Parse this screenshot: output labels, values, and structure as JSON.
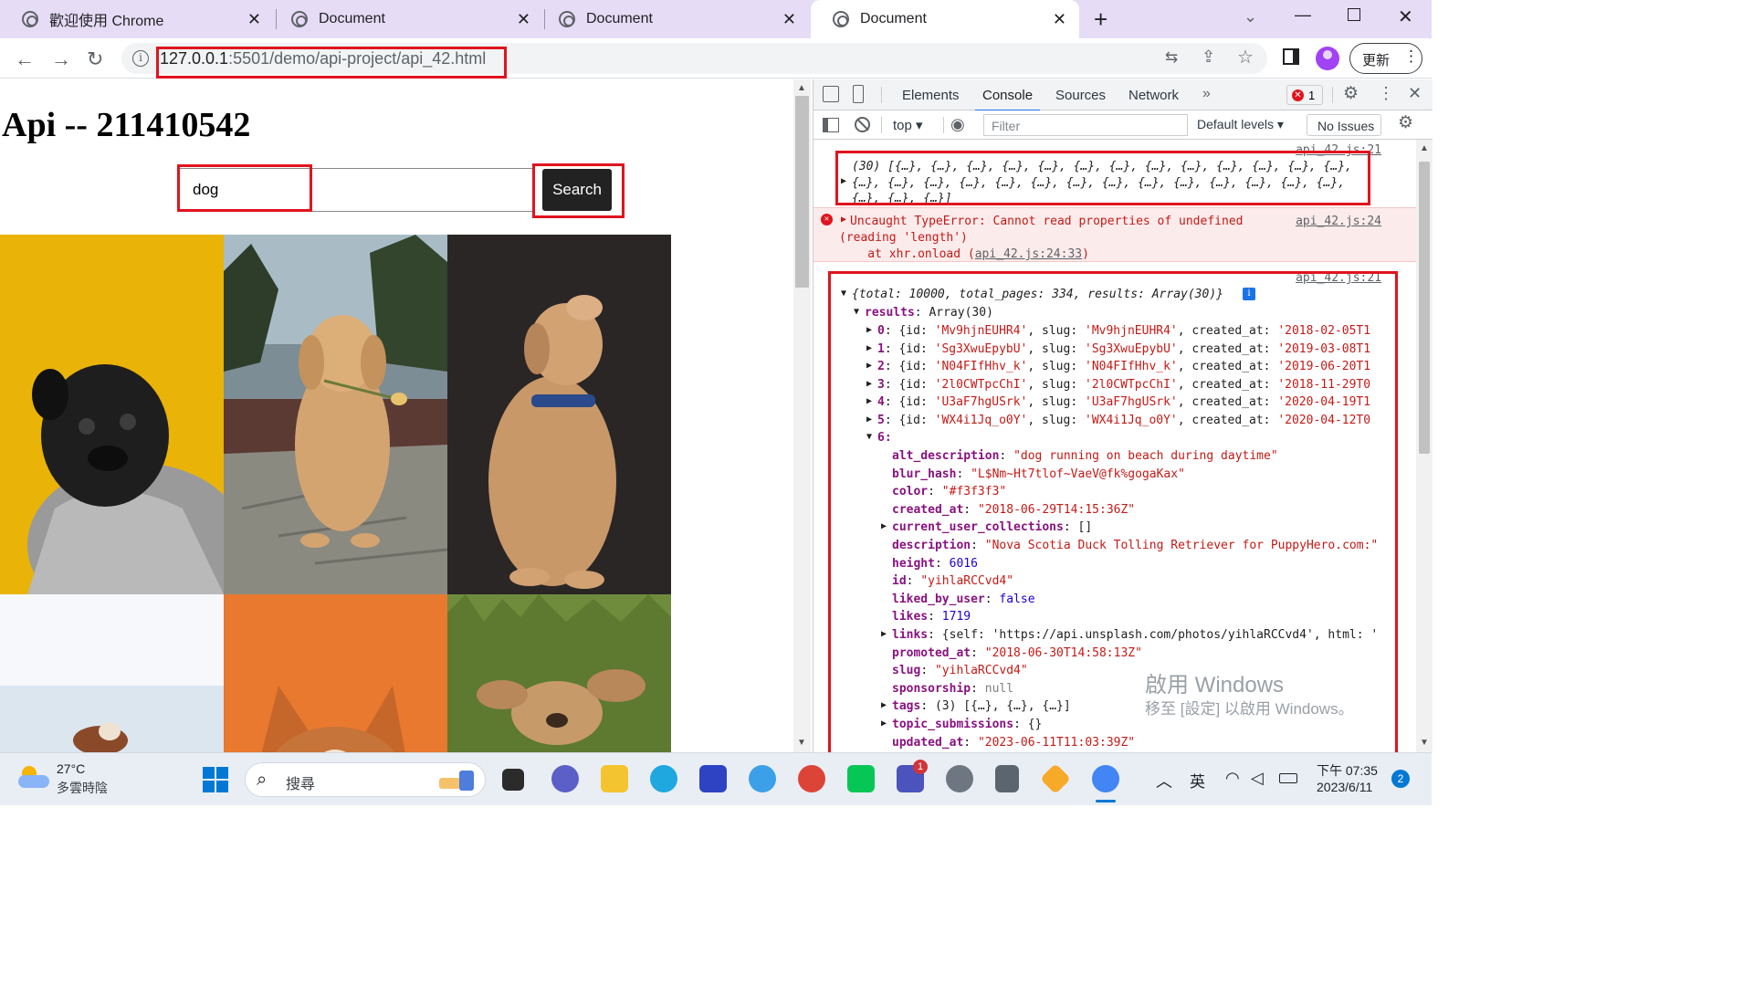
{
  "browser": {
    "tabs": [
      {
        "title": "歡迎使用 Chrome",
        "active": false
      },
      {
        "title": "Document",
        "active": false
      },
      {
        "title": "Document",
        "active": false
      },
      {
        "title": "Document",
        "active": true
      }
    ],
    "new_tab_label": "+",
    "url_host": "127.0.0.1",
    "url_rest": ":5501/demo/api-project/api_42.html",
    "update_button": "更新"
  },
  "page": {
    "title": "Api -- 211410542",
    "search_value": "dog",
    "search_button": "Search",
    "tiles": [
      {
        "subject": "black pug in grey sweater",
        "bg": "#e9b308"
      },
      {
        "subject": "golden retriever puppy holding rose",
        "bg": "#8b8a7e"
      },
      {
        "subject": "labrador with blue collar",
        "bg": "#2a2626"
      },
      {
        "subject": "dog on beach",
        "bg": "#f4f6f8"
      },
      {
        "subject": "corgi on orange background",
        "bg": "#e8792f"
      },
      {
        "subject": "puppy in grass",
        "bg": "#6e8a3e"
      }
    ]
  },
  "devtools": {
    "tabs": [
      "Elements",
      "Console",
      "Sources",
      "Network"
    ],
    "active_tab": "Console",
    "error_count": "1",
    "context": "top",
    "filter_placeholder": "Filter",
    "levels": "Default levels",
    "issues": "No Issues",
    "log1": {
      "source": "api_42.js:21",
      "line1": "(30) [{…}, {…}, {…}, {…}, {…}, {…}, {…}, {…}, {…}, {…}, {…}, {…}, {…},",
      "line2": "{…}, {…}, {…}, {…}, {…}, {…}, {…}, {…}, {…}, {…}, {…}, {…}, {…}, {…},",
      "line3": "{…}, {…}, {…}]"
    },
    "error": {
      "source": "api_42.js:24",
      "line1": "Uncaught TypeError: Cannot read properties of undefined",
      "line2": "(reading 'length')",
      "line3_prefix": "    at xhr.onload (",
      "line3_link": "api_42.js:24:33",
      "line3_suffix": ")"
    },
    "log2": {
      "source": "api_42.js:21",
      "summary": "{total: 10000, total_pages: 334, results: Array(30)}",
      "results_label": "results: Array(30)",
      "rows": [
        {
          "idx": "0",
          "id": "'Mv9hjnEUHR4'",
          "slug": "'Mv9hjnEUHR4'",
          "created": "'2018-02-05T1"
        },
        {
          "idx": "1",
          "id": "'Sg3XwuEpybU'",
          "slug": "'Sg3XwuEpybU'",
          "created": "'2019-03-08T1"
        },
        {
          "idx": "2",
          "id": "'N04FIfHhv_k'",
          "slug": "'N04FIfHhv_k'",
          "created": "'2019-06-20T1"
        },
        {
          "idx": "3",
          "id": "'2l0CWTpcChI'",
          "slug": "'2l0CWTpcChI'",
          "created": "'2018-11-29T0"
        },
        {
          "idx": "4",
          "id": "'U3aF7hgUSrk'",
          "slug": "'U3aF7hgUSrk'",
          "created": "'2020-04-19T1"
        },
        {
          "idx": "5",
          "id": "'WX4i1Jq_o0Y'",
          "slug": "'WX4i1Jq_o0Y'",
          "created": "'2020-04-12T0"
        }
      ],
      "item6_label": "6:",
      "props": [
        {
          "key": "alt_description",
          "value": "\"dog running on beach during daytime\"",
          "type": "s",
          "expand": false
        },
        {
          "key": "blur_hash",
          "value": "\"L$Nm~Ht7tlof~VaeV@fk%gogaKax\"",
          "type": "s",
          "expand": false
        },
        {
          "key": "color",
          "value": "\"#f3f3f3\"",
          "type": "s",
          "expand": false
        },
        {
          "key": "created_at",
          "value": "\"2018-06-29T14:15:36Z\"",
          "type": "s",
          "expand": false
        },
        {
          "key": "current_user_collections",
          "value": "[]",
          "type": "p",
          "expand": true
        },
        {
          "key": "description",
          "value": "\"Nova Scotia Duck Tolling Retriever for PuppyHero.com:\"",
          "type": "s",
          "expand": false
        },
        {
          "key": "height",
          "value": "6016",
          "type": "n",
          "expand": false
        },
        {
          "key": "id",
          "value": "\"yihlaRCCvd4\"",
          "type": "s",
          "expand": false
        },
        {
          "key": "liked_by_user",
          "value": "false",
          "type": "n",
          "expand": false
        },
        {
          "key": "likes",
          "value": "1719",
          "type": "n",
          "expand": false
        },
        {
          "key": "links",
          "value": "{self: 'https://api.unsplash.com/photos/yihlaRCCvd4', html: '",
          "type": "p",
          "expand": true
        },
        {
          "key": "promoted_at",
          "value": "\"2018-06-30T14:58:13Z\"",
          "type": "s",
          "expand": false
        },
        {
          "key": "slug",
          "value": "\"yihlaRCCvd4\"",
          "type": "s",
          "expand": false
        },
        {
          "key": "sponsorship",
          "value": "null",
          "type": "g",
          "expand": false
        },
        {
          "key": "tags",
          "value": "(3) [{…}, {…}, {…}]",
          "type": "p",
          "expand": true
        },
        {
          "key": "topic_submissions",
          "value": "{}",
          "type": "p",
          "expand": true
        },
        {
          "key": "updated_at",
          "value": "\"2023-06-11T11:03:39Z\"",
          "type": "s",
          "expand": false
        }
      ]
    }
  },
  "watermark": {
    "line1": "啟用 Windows",
    "line2": "移至 [設定] 以啟用 Windows。"
  },
  "taskbar": {
    "weather_temp": "27°C",
    "weather_desc": "多雲時陰",
    "search_placeholder": "搜尋",
    "ime": "英",
    "time": "下午 07:35",
    "date": "2023/6/11",
    "notification_count": "2",
    "teams_badge": "1"
  },
  "colors": {
    "accent": "#1a73e8",
    "highlight_box": "#e0141e",
    "tabstrip": "#e6dcf6",
    "error_bg": "#fcebeb"
  }
}
